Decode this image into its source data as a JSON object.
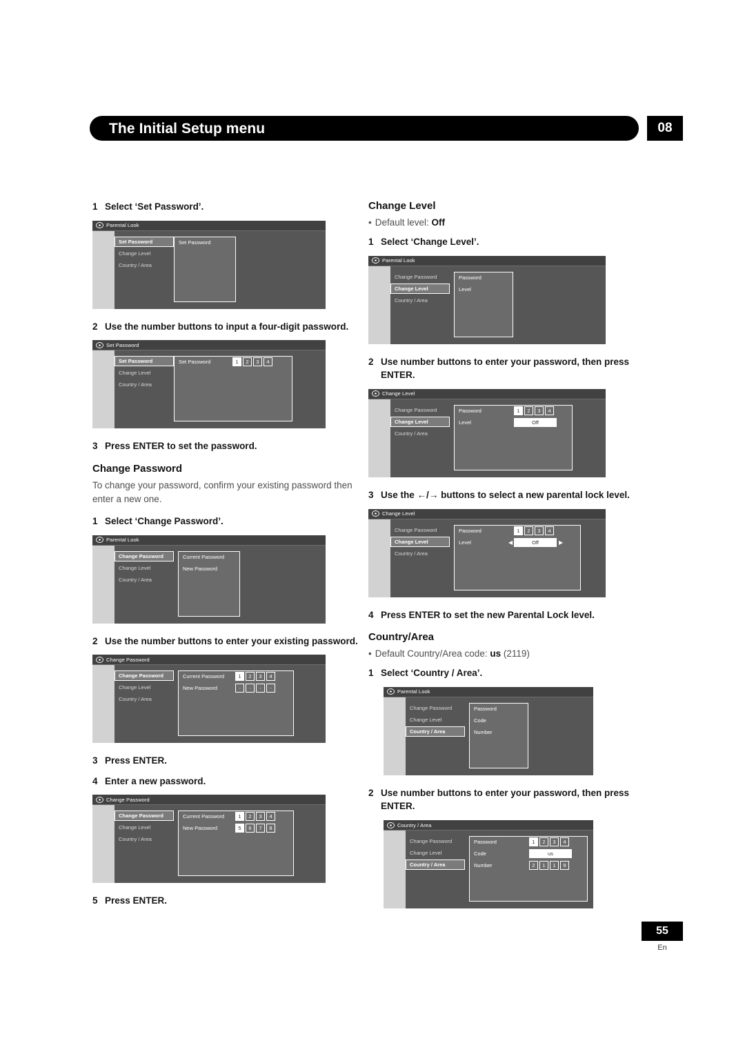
{
  "header": {
    "title": "The Initial Setup menu",
    "chapter": "08"
  },
  "footer": {
    "page": "55",
    "lang": "En"
  },
  "left_column": {
    "step1": {
      "num": "1",
      "text": "Select ‘Set Password’."
    },
    "osd1": {
      "title": "Parental Look",
      "menu": [
        "Set Password",
        "Change Level",
        "Country / Area"
      ],
      "panel_rows": [
        "Set Password"
      ]
    },
    "step2": {
      "num": "2",
      "text": "Use the number buttons to input a four-digit password."
    },
    "osd2": {
      "title": "Set Password",
      "menu": [
        "Set Password",
        "Change Level",
        "Country / Area"
      ],
      "panel_rows": [
        "Set Password"
      ],
      "digits": [
        "1",
        "2",
        "3",
        "4"
      ]
    },
    "step3": {
      "num": "3",
      "text": "Press ENTER to set the password."
    },
    "section_change_password": "Change Password",
    "change_password_body": "To change your password, confirm your existing password then enter a new one.",
    "step4": {
      "num": "1",
      "text": "Select ‘Change Password’."
    },
    "osd3": {
      "title": "Parental Look",
      "menu": [
        "Change Password",
        "Change Level",
        "Country / Area"
      ],
      "panel_rows": [
        "Current Password",
        "New Password"
      ]
    },
    "step5": {
      "num": "2",
      "text": "Use the number buttons to enter your existing password."
    },
    "osd4": {
      "title": "Change Password",
      "menu": [
        "Change Password",
        "Change Level",
        "Country / Area"
      ],
      "panel_rows": [
        "Current Password",
        "New Password"
      ],
      "digits_row1": [
        "1",
        "2",
        "3",
        "4"
      ],
      "digits_row2": [
        "-",
        "-",
        "-",
        "-"
      ]
    },
    "step6": {
      "num": "3",
      "text": "Press ENTER."
    },
    "step7": {
      "num": "4",
      "text": "Enter a new password."
    },
    "osd5": {
      "title": "Change Password",
      "menu": [
        "Change Password",
        "Change Level",
        "Country / Area"
      ],
      "panel_rows": [
        "Current Password",
        "New Password"
      ],
      "digits_row1": [
        "1",
        "2",
        "3",
        "4"
      ],
      "digits_row2": [
        "5",
        "6",
        "7",
        "8"
      ]
    },
    "step8": {
      "num": "5",
      "text": "Press ENTER."
    }
  },
  "right_column": {
    "section_change_level": "Change Level",
    "default_level_bullet": "Default level:",
    "default_level_value": "Off",
    "step1": {
      "num": "1",
      "text": "Select ‘Change Level’."
    },
    "osd1": {
      "title": "Parental Look",
      "menu": [
        "Change Password",
        "Change Level",
        "Country / Area"
      ],
      "panel_rows": [
        "Password",
        "Level"
      ]
    },
    "step2": {
      "num": "2",
      "text": "Use number buttons to enter your password, then press ENTER."
    },
    "osd2": {
      "title": "Change Level",
      "menu": [
        "Change Password",
        "Change Level",
        "Country / Area"
      ],
      "panel_rows": [
        "Password",
        "Level"
      ],
      "digits": [
        "1",
        "2",
        "3",
        "4"
      ],
      "value": "Off"
    },
    "step3": {
      "num": "3",
      "text_before": "Use the",
      "text_after": "buttons to select a new parental lock level.",
      "left_arrow": "←",
      "right_arrow": "→"
    },
    "osd3": {
      "title": "Change Level",
      "menu": [
        "Change Password",
        "Change Level",
        "Country / Area"
      ],
      "panel_rows": [
        "Password",
        "Level"
      ],
      "digits": [
        "1",
        "2",
        "3",
        "4"
      ],
      "value": "Off",
      "left_cursor": "◀",
      "right_cursor": "▶"
    },
    "step4": {
      "num": "4",
      "text": "Press ENTER to set the new Parental Lock level."
    },
    "section_country_area": "Country/Area",
    "default_country_bullet": "Default Country/Area code:",
    "default_country_value": "us",
    "default_country_paren": "(2119)",
    "step5": {
      "num": "1",
      "text": "Select ‘Country / Area’."
    },
    "osd4": {
      "title": "Parental Look",
      "menu": [
        "Change Password",
        "Change Level",
        "Country / Area"
      ],
      "panel_rows": [
        "Password",
        "Code",
        "Number"
      ]
    },
    "step6": {
      "num": "2",
      "text": "Use number buttons to enter your password, then press ENTER."
    },
    "osd5": {
      "title": "Country / Area",
      "menu": [
        "Change Password",
        "Change Level",
        "Country / Area"
      ],
      "panel_rows": [
        "Password",
        "Code",
        "Number"
      ],
      "digits": [
        "1",
        "2",
        "3",
        "4"
      ],
      "code_value": "us",
      "number_digits": [
        "2",
        "1",
        "1",
        "9"
      ]
    }
  }
}
